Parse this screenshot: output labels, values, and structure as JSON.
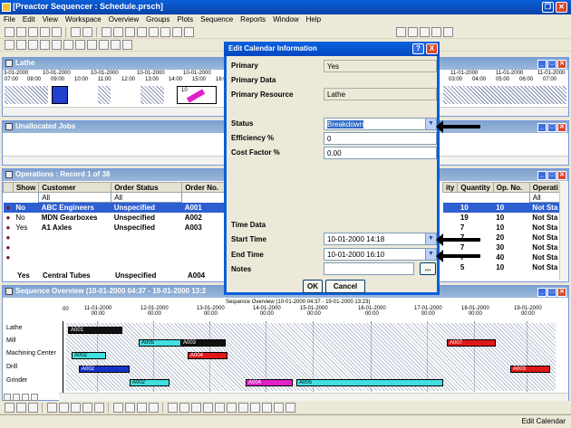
{
  "app": {
    "title": "[Preactor Sequencer : Schedule.prsch]"
  },
  "menu": [
    "File",
    "Edit",
    "View",
    "Workspace",
    "Overview",
    "Groups",
    "Plots",
    "Sequence",
    "Reports",
    "Window",
    "Help"
  ],
  "lathe_panel": {
    "title": "Lathe",
    "dates": [
      "3-01-2000",
      "10-01-2000",
      "10-01-2000",
      "10-01-2000",
      "10-01-2000",
      "10-01-2000"
    ],
    "times": [
      "07:00",
      "08:00",
      "09:00",
      "10:00",
      "11:00",
      "12:00",
      "13:00",
      "14:00",
      "15:00",
      "16:00"
    ],
    "right_dates": [
      "11-01-2000",
      "11-01-2000",
      "11-01-2000"
    ],
    "right_times": [
      "03:00",
      "04:00",
      "05:00",
      "06:00",
      "07:00"
    ],
    "bar_label": "10"
  },
  "unallocated_panel": {
    "title": "Unallocated Jobs"
  },
  "operations_panel": {
    "title": "Operations : Record 1 of 38",
    "headers": {
      "show": "Show",
      "customer": "Customer",
      "order_status": "Order Status",
      "order_no": "Order No.",
      "ity": "ity",
      "quantity": "Quantity",
      "op_no": "Op. No.",
      "operation": "Operati"
    },
    "filter_all": "All",
    "rows": [
      {
        "show": "No",
        "customer": "ABC Engineers",
        "status": "Unspecified",
        "order": "A001",
        "qty": "10",
        "op": "10",
        "opstatus": "Not Sta"
      },
      {
        "show": "No",
        "customer": "MDN Gearboxes",
        "status": "Unspecified",
        "order": "A002",
        "qty": "19",
        "op": "10",
        "opstatus": "Not Sta"
      },
      {
        "show": "Yes",
        "customer": "A1 Axles",
        "status": "Unspecified",
        "order": "A003",
        "qty": "7",
        "op": "10",
        "opstatus": "Not Sta"
      },
      {
        "show": "",
        "customer": "",
        "status": "",
        "order": "",
        "qty": "7",
        "op": "20",
        "opstatus": "Not Sta"
      },
      {
        "show": "",
        "customer": "",
        "status": "",
        "order": "",
        "qty": "7",
        "op": "30",
        "opstatus": "Not Sta"
      },
      {
        "show": "",
        "customer": "",
        "status": "",
        "order": "",
        "qty": "7",
        "op": "40",
        "opstatus": "Not Sta"
      },
      {
        "show": "Yes",
        "customer": "Central Tubes",
        "status": "Unspecified",
        "order": "A004",
        "qty": "5",
        "op": "10",
        "opstatus": "Not Sta"
      }
    ]
  },
  "sequence_panel": {
    "title": "Sequence Overview   (10-01-2000 04:37 - 19-01-2000 13:2",
    "header": "Sequence Overview   (10-01-2000 04:37 - 19-01-2000 13:23)",
    "days": [
      {
        "date": "11-01-2000",
        "time": "00:00"
      },
      {
        "date": "12-01-2000",
        "time": "00:00"
      },
      {
        "date": "13-01-2000",
        "time": "00:00"
      },
      {
        "date": "14-01-2000",
        "time": "00:00"
      },
      {
        "date": "15-01-2000",
        "time": "00:00"
      },
      {
        "date": "16-01-2000",
        "time": "00:00"
      },
      {
        "date": "17-01-2000",
        "time": "00:00"
      },
      {
        "date": "18-01-2000",
        "time": "00:00"
      },
      {
        "date": "19-01-2000",
        "time": "00:00"
      }
    ],
    "resources": [
      "Lathe",
      "Mill",
      "Machining Center",
      "Drill",
      "Grinder"
    ],
    "bar_labels": {
      "lathe": "A001",
      "mill1": "A005",
      "mill2": "A003",
      "mc1": "A002",
      "mc2": "A004",
      "mc3": "A007",
      "drill1": "A002",
      "drill2": "A003",
      "grinder1": "A002",
      "grinder2": "A004",
      "grinder3": "A005"
    },
    "axis_start": "00"
  },
  "dialog": {
    "title": "Edit Calendar Information",
    "primary_label": "Primary",
    "primary_value": "Yes",
    "primary_data_label": "Primary Data",
    "primary_resource_label": "Primary Resource",
    "primary_resource_value": "Lathe",
    "status_label": "Status",
    "status_value": "Breakdown",
    "efficiency_label": "Efficiency %",
    "efficiency_value": "0",
    "cost_label": "Cost Factor %",
    "cost_value": "0.00",
    "time_data_label": "Time Data",
    "start_label": "Start Time",
    "start_value": "10-01-2000 14:18",
    "end_label": "End Time",
    "end_value": "10-01-2000 16:10",
    "notes_label": "Notes",
    "notes_value": "",
    "ellipsis": "...",
    "ok": "OK",
    "cancel": "Cancel",
    "help": "?",
    "close": "X"
  },
  "status_bar": {
    "text": "Edit Calendar"
  },
  "colors": {
    "title_blue": "#0a5fd8",
    "selected_row": "#2e5fd0",
    "bar_blue": "#1432c8",
    "bar_cyan": "#40e0e0",
    "bar_red": "#e01818",
    "bar_magenta": "#e020c8",
    "bar_black": "#101010"
  }
}
